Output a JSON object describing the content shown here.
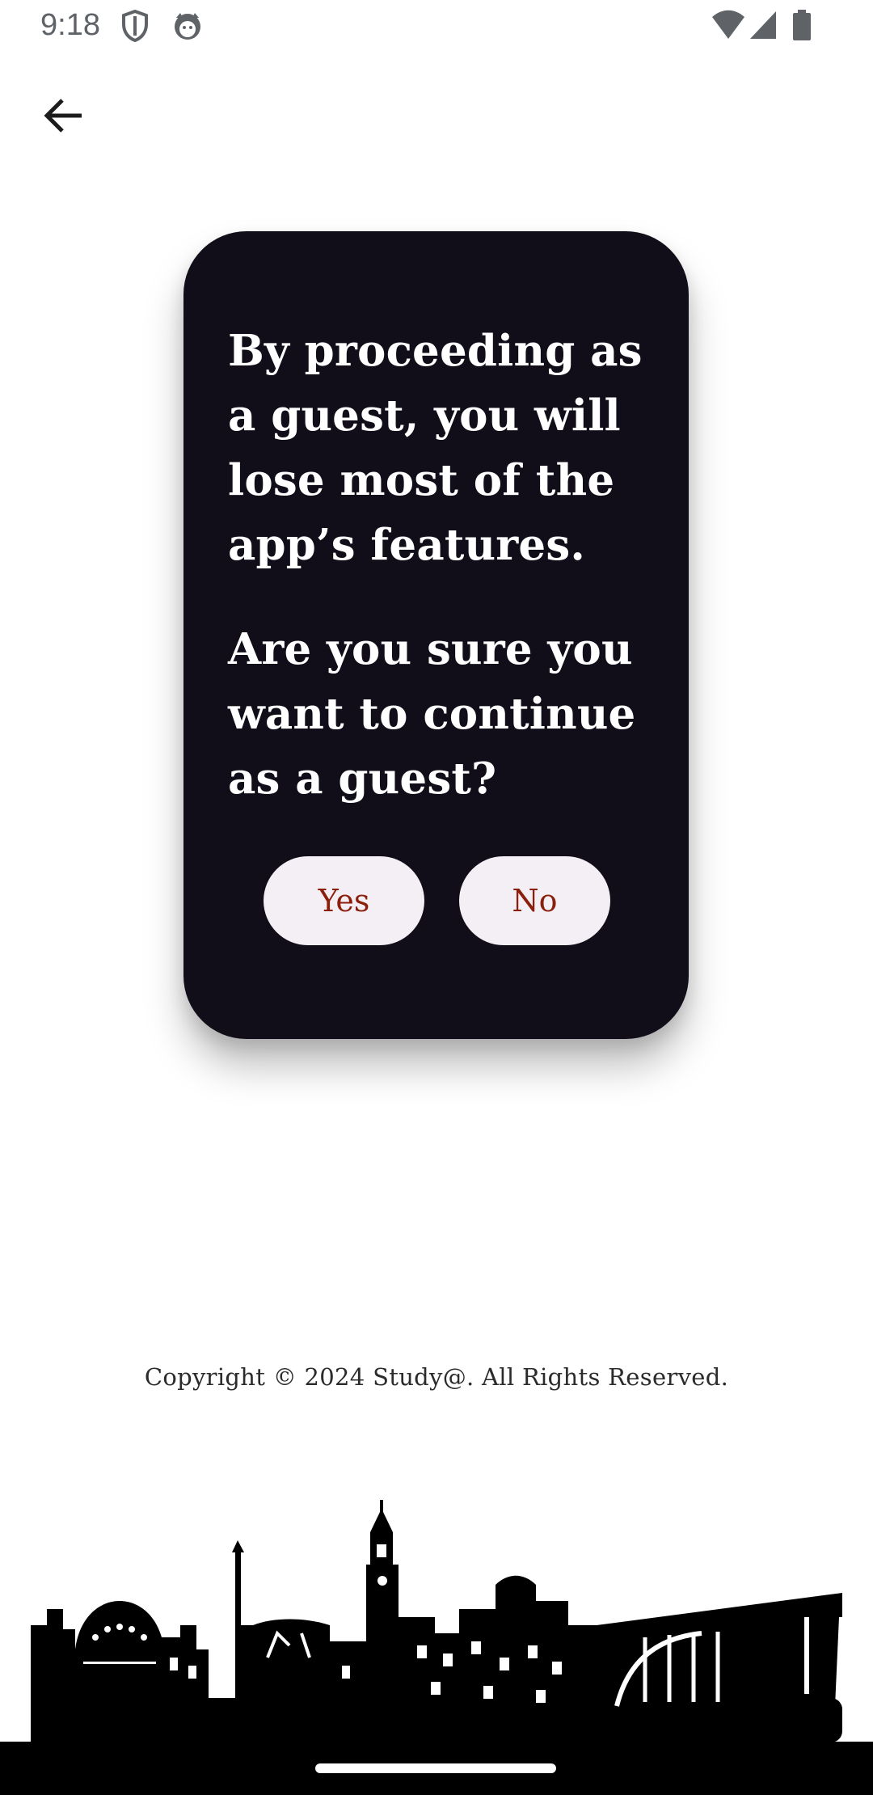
{
  "status_bar": {
    "time": "9:18",
    "icons": [
      "shield-icon",
      "cat-icon",
      "wifi-icon",
      "signal-icon",
      "battery-icon"
    ]
  },
  "header": {
    "back_icon": "arrow-left-icon"
  },
  "dialog": {
    "warning": "By proceeding as a guest, you will lose most of the app’s features.",
    "question": "Are you sure you want to continue as a guest?",
    "yes_label": "Yes",
    "no_label": "No"
  },
  "footer": {
    "copyright": "Copyright © 2024 Study@. All Rights Reserved."
  },
  "colors": {
    "dialog_bg": "#110e1a",
    "button_bg": "#f4eff5",
    "button_text": "#8b1f0c",
    "text_on_dark": "#ffffff"
  }
}
